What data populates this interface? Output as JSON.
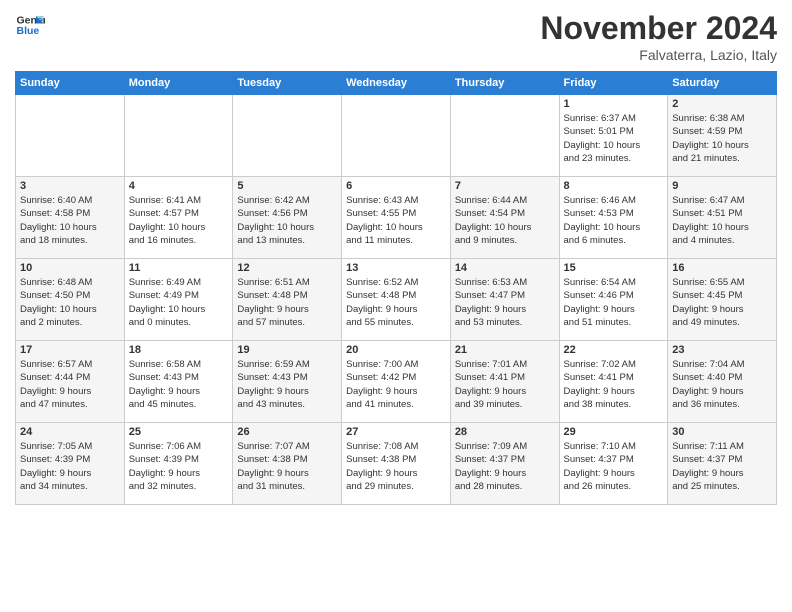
{
  "logo": {
    "line1": "General",
    "line2": "Blue"
  },
  "title": "November 2024",
  "subtitle": "Falvaterra, Lazio, Italy",
  "weekdays": [
    "Sunday",
    "Monday",
    "Tuesday",
    "Wednesday",
    "Thursday",
    "Friday",
    "Saturday"
  ],
  "weeks": [
    [
      {
        "day": "",
        "info": ""
      },
      {
        "day": "",
        "info": ""
      },
      {
        "day": "",
        "info": ""
      },
      {
        "day": "",
        "info": ""
      },
      {
        "day": "",
        "info": ""
      },
      {
        "day": "1",
        "info": "Sunrise: 6:37 AM\nSunset: 5:01 PM\nDaylight: 10 hours\nand 23 minutes."
      },
      {
        "day": "2",
        "info": "Sunrise: 6:38 AM\nSunset: 4:59 PM\nDaylight: 10 hours\nand 21 minutes."
      }
    ],
    [
      {
        "day": "3",
        "info": "Sunrise: 6:40 AM\nSunset: 4:58 PM\nDaylight: 10 hours\nand 18 minutes."
      },
      {
        "day": "4",
        "info": "Sunrise: 6:41 AM\nSunset: 4:57 PM\nDaylight: 10 hours\nand 16 minutes."
      },
      {
        "day": "5",
        "info": "Sunrise: 6:42 AM\nSunset: 4:56 PM\nDaylight: 10 hours\nand 13 minutes."
      },
      {
        "day": "6",
        "info": "Sunrise: 6:43 AM\nSunset: 4:55 PM\nDaylight: 10 hours\nand 11 minutes."
      },
      {
        "day": "7",
        "info": "Sunrise: 6:44 AM\nSunset: 4:54 PM\nDaylight: 10 hours\nand 9 minutes."
      },
      {
        "day": "8",
        "info": "Sunrise: 6:46 AM\nSunset: 4:53 PM\nDaylight: 10 hours\nand 6 minutes."
      },
      {
        "day": "9",
        "info": "Sunrise: 6:47 AM\nSunset: 4:51 PM\nDaylight: 10 hours\nand 4 minutes."
      }
    ],
    [
      {
        "day": "10",
        "info": "Sunrise: 6:48 AM\nSunset: 4:50 PM\nDaylight: 10 hours\nand 2 minutes."
      },
      {
        "day": "11",
        "info": "Sunrise: 6:49 AM\nSunset: 4:49 PM\nDaylight: 10 hours\nand 0 minutes."
      },
      {
        "day": "12",
        "info": "Sunrise: 6:51 AM\nSunset: 4:48 PM\nDaylight: 9 hours\nand 57 minutes."
      },
      {
        "day": "13",
        "info": "Sunrise: 6:52 AM\nSunset: 4:48 PM\nDaylight: 9 hours\nand 55 minutes."
      },
      {
        "day": "14",
        "info": "Sunrise: 6:53 AM\nSunset: 4:47 PM\nDaylight: 9 hours\nand 53 minutes."
      },
      {
        "day": "15",
        "info": "Sunrise: 6:54 AM\nSunset: 4:46 PM\nDaylight: 9 hours\nand 51 minutes."
      },
      {
        "day": "16",
        "info": "Sunrise: 6:55 AM\nSunset: 4:45 PM\nDaylight: 9 hours\nand 49 minutes."
      }
    ],
    [
      {
        "day": "17",
        "info": "Sunrise: 6:57 AM\nSunset: 4:44 PM\nDaylight: 9 hours\nand 47 minutes."
      },
      {
        "day": "18",
        "info": "Sunrise: 6:58 AM\nSunset: 4:43 PM\nDaylight: 9 hours\nand 45 minutes."
      },
      {
        "day": "19",
        "info": "Sunrise: 6:59 AM\nSunset: 4:43 PM\nDaylight: 9 hours\nand 43 minutes."
      },
      {
        "day": "20",
        "info": "Sunrise: 7:00 AM\nSunset: 4:42 PM\nDaylight: 9 hours\nand 41 minutes."
      },
      {
        "day": "21",
        "info": "Sunrise: 7:01 AM\nSunset: 4:41 PM\nDaylight: 9 hours\nand 39 minutes."
      },
      {
        "day": "22",
        "info": "Sunrise: 7:02 AM\nSunset: 4:41 PM\nDaylight: 9 hours\nand 38 minutes."
      },
      {
        "day": "23",
        "info": "Sunrise: 7:04 AM\nSunset: 4:40 PM\nDaylight: 9 hours\nand 36 minutes."
      }
    ],
    [
      {
        "day": "24",
        "info": "Sunrise: 7:05 AM\nSunset: 4:39 PM\nDaylight: 9 hours\nand 34 minutes."
      },
      {
        "day": "25",
        "info": "Sunrise: 7:06 AM\nSunset: 4:39 PM\nDaylight: 9 hours\nand 32 minutes."
      },
      {
        "day": "26",
        "info": "Sunrise: 7:07 AM\nSunset: 4:38 PM\nDaylight: 9 hours\nand 31 minutes."
      },
      {
        "day": "27",
        "info": "Sunrise: 7:08 AM\nSunset: 4:38 PM\nDaylight: 9 hours\nand 29 minutes."
      },
      {
        "day": "28",
        "info": "Sunrise: 7:09 AM\nSunset: 4:37 PM\nDaylight: 9 hours\nand 28 minutes."
      },
      {
        "day": "29",
        "info": "Sunrise: 7:10 AM\nSunset: 4:37 PM\nDaylight: 9 hours\nand 26 minutes."
      },
      {
        "day": "30",
        "info": "Sunrise: 7:11 AM\nSunset: 4:37 PM\nDaylight: 9 hours\nand 25 minutes."
      }
    ]
  ]
}
